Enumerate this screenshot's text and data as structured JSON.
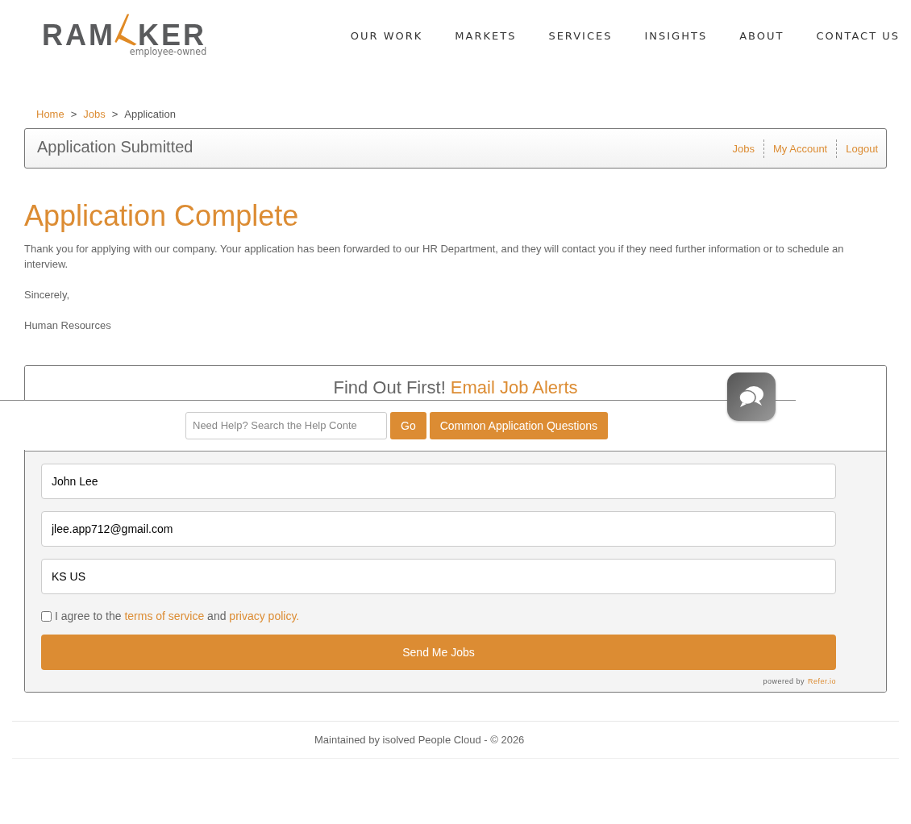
{
  "logo": {
    "parts": [
      "RAM",
      "KER"
    ],
    "tagline": "employee-owned"
  },
  "nav": [
    "OUR WORK",
    "MARKETS",
    "SERVICES",
    "INSIGHTS",
    "ABOUT",
    "CONTACT US"
  ],
  "breadcrumb": [
    {
      "label": "Home",
      "link": true
    },
    {
      "label": "Jobs",
      "link": true
    },
    {
      "label": "Application",
      "link": false
    }
  ],
  "breadcrumb_separator": ">",
  "header_panel": {
    "title": "Application Submitted",
    "links": [
      "Jobs",
      "My Account",
      "Logout"
    ]
  },
  "heading": "Application Complete",
  "paragraphs": [
    "Thank you for applying with our company. Your application has been forwarded to our HR Department, and they will contact you if they need further information or to schedule an interview.",
    "Sincerely,",
    "Human Resources"
  ],
  "alerts": {
    "title": "Find Out First!",
    "title_accent": "Email Job Alerts",
    "fields": [
      {
        "value": "John Lee"
      },
      {
        "value": "jlee.app712@gmail.com"
      },
      {
        "value": "KS US"
      }
    ],
    "agree": {
      "checked": false,
      "text_1": "I agree to the",
      "link_1": "terms of service",
      "text_2": "and",
      "link_2": "privacy policy."
    },
    "submit": "Send Me Jobs",
    "powered_by": "powered by",
    "powered_link": "Refer.io"
  },
  "help_bar": {
    "placeholder": "Need Help? Search the Help Conte",
    "go": "Go",
    "questions": "Common Application Questions"
  },
  "footer": "Maintained by isolved People Cloud - © 2026"
}
